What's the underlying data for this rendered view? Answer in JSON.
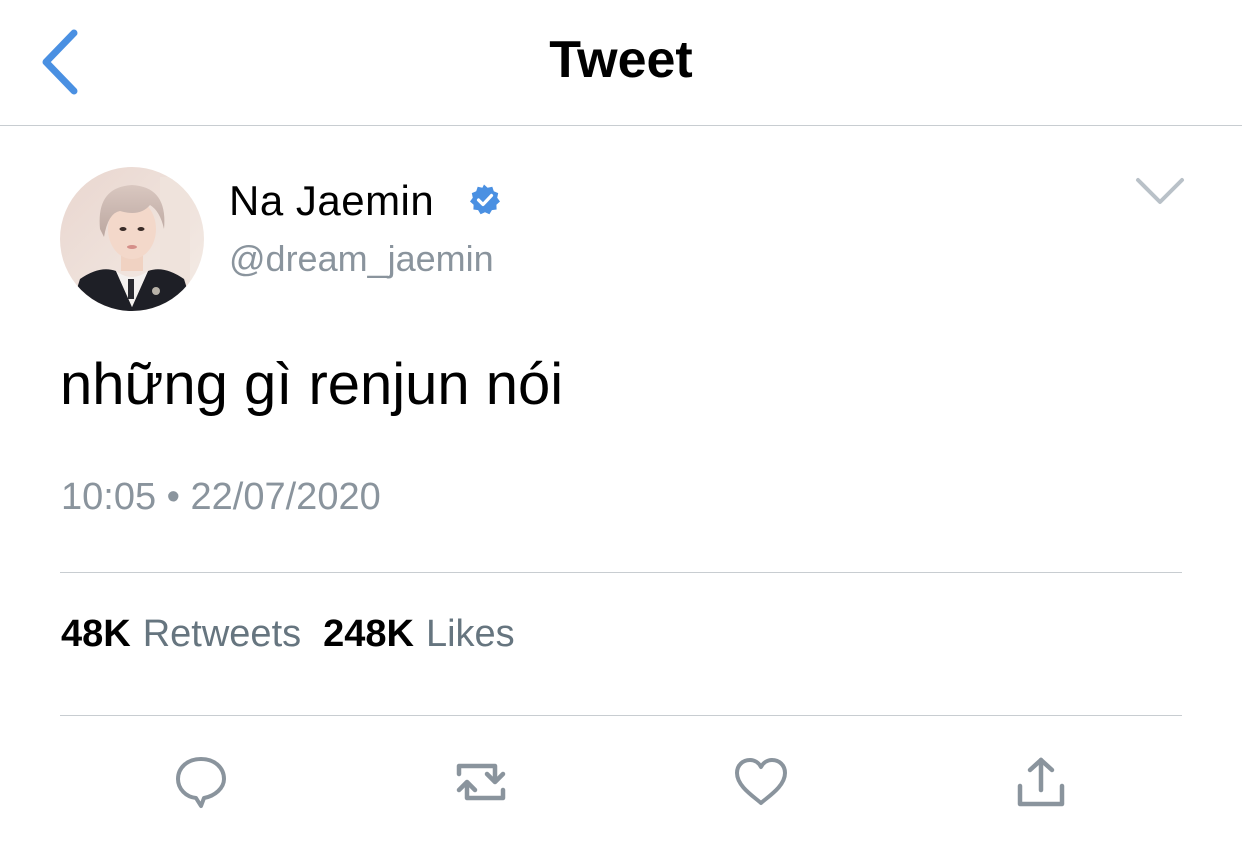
{
  "header": {
    "title": "Tweet",
    "back_icon": "chevron-left-icon"
  },
  "tweet": {
    "author": {
      "display_name": "Na Jaemin",
      "handle": "@dream_jaemin",
      "verified": true
    },
    "text": "những gì renjun nói",
    "time": "10:05",
    "separator": "•",
    "date": "22/07/2020",
    "stats": {
      "retweets_count": "48K",
      "retweets_label": "Retweets",
      "likes_count": "248K",
      "likes_label": "Likes"
    }
  },
  "actions": [
    {
      "name": "reply",
      "icon": "reply-icon"
    },
    {
      "name": "retweet",
      "icon": "retweet-icon"
    },
    {
      "name": "like",
      "icon": "heart-icon"
    },
    {
      "name": "share",
      "icon": "share-icon"
    }
  ],
  "colors": {
    "accent": "#4a90e2",
    "verified": "#4a90e2",
    "secondary_text": "#8a949d",
    "icon_gray": "#8a949d",
    "divider": "#c8cdd1"
  }
}
